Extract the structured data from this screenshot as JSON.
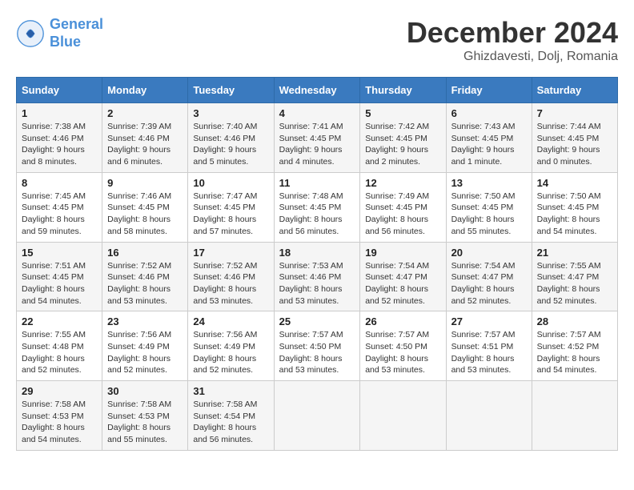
{
  "logo": {
    "line1": "General",
    "line2": "Blue"
  },
  "title": "December 2024",
  "subtitle": "Ghizdavesti, Dolj, Romania",
  "days_of_week": [
    "Sunday",
    "Monday",
    "Tuesday",
    "Wednesday",
    "Thursday",
    "Friday",
    "Saturday"
  ],
  "weeks": [
    [
      {
        "day": "1",
        "sunrise": "7:38 AM",
        "sunset": "4:46 PM",
        "daylight": "9 hours and 8 minutes."
      },
      {
        "day": "2",
        "sunrise": "7:39 AM",
        "sunset": "4:46 PM",
        "daylight": "9 hours and 6 minutes."
      },
      {
        "day": "3",
        "sunrise": "7:40 AM",
        "sunset": "4:46 PM",
        "daylight": "9 hours and 5 minutes."
      },
      {
        "day": "4",
        "sunrise": "7:41 AM",
        "sunset": "4:45 PM",
        "daylight": "9 hours and 4 minutes."
      },
      {
        "day": "5",
        "sunrise": "7:42 AM",
        "sunset": "4:45 PM",
        "daylight": "9 hours and 2 minutes."
      },
      {
        "day": "6",
        "sunrise": "7:43 AM",
        "sunset": "4:45 PM",
        "daylight": "9 hours and 1 minute."
      },
      {
        "day": "7",
        "sunrise": "7:44 AM",
        "sunset": "4:45 PM",
        "daylight": "9 hours and 0 minutes."
      }
    ],
    [
      {
        "day": "8",
        "sunrise": "7:45 AM",
        "sunset": "4:45 PM",
        "daylight": "8 hours and 59 minutes."
      },
      {
        "day": "9",
        "sunrise": "7:46 AM",
        "sunset": "4:45 PM",
        "daylight": "8 hours and 58 minutes."
      },
      {
        "day": "10",
        "sunrise": "7:47 AM",
        "sunset": "4:45 PM",
        "daylight": "8 hours and 57 minutes."
      },
      {
        "day": "11",
        "sunrise": "7:48 AM",
        "sunset": "4:45 PM",
        "daylight": "8 hours and 56 minutes."
      },
      {
        "day": "12",
        "sunrise": "7:49 AM",
        "sunset": "4:45 PM",
        "daylight": "8 hours and 56 minutes."
      },
      {
        "day": "13",
        "sunrise": "7:50 AM",
        "sunset": "4:45 PM",
        "daylight": "8 hours and 55 minutes."
      },
      {
        "day": "14",
        "sunrise": "7:50 AM",
        "sunset": "4:45 PM",
        "daylight": "8 hours and 54 minutes."
      }
    ],
    [
      {
        "day": "15",
        "sunrise": "7:51 AM",
        "sunset": "4:45 PM",
        "daylight": "8 hours and 54 minutes."
      },
      {
        "day": "16",
        "sunrise": "7:52 AM",
        "sunset": "4:46 PM",
        "daylight": "8 hours and 53 minutes."
      },
      {
        "day": "17",
        "sunrise": "7:52 AM",
        "sunset": "4:46 PM",
        "daylight": "8 hours and 53 minutes."
      },
      {
        "day": "18",
        "sunrise": "7:53 AM",
        "sunset": "4:46 PM",
        "daylight": "8 hours and 53 minutes."
      },
      {
        "day": "19",
        "sunrise": "7:54 AM",
        "sunset": "4:47 PM",
        "daylight": "8 hours and 52 minutes."
      },
      {
        "day": "20",
        "sunrise": "7:54 AM",
        "sunset": "4:47 PM",
        "daylight": "8 hours and 52 minutes."
      },
      {
        "day": "21",
        "sunrise": "7:55 AM",
        "sunset": "4:47 PM",
        "daylight": "8 hours and 52 minutes."
      }
    ],
    [
      {
        "day": "22",
        "sunrise": "7:55 AM",
        "sunset": "4:48 PM",
        "daylight": "8 hours and 52 minutes."
      },
      {
        "day": "23",
        "sunrise": "7:56 AM",
        "sunset": "4:49 PM",
        "daylight": "8 hours and 52 minutes."
      },
      {
        "day": "24",
        "sunrise": "7:56 AM",
        "sunset": "4:49 PM",
        "daylight": "8 hours and 52 minutes."
      },
      {
        "day": "25",
        "sunrise": "7:57 AM",
        "sunset": "4:50 PM",
        "daylight": "8 hours and 53 minutes."
      },
      {
        "day": "26",
        "sunrise": "7:57 AM",
        "sunset": "4:50 PM",
        "daylight": "8 hours and 53 minutes."
      },
      {
        "day": "27",
        "sunrise": "7:57 AM",
        "sunset": "4:51 PM",
        "daylight": "8 hours and 53 minutes."
      },
      {
        "day": "28",
        "sunrise": "7:57 AM",
        "sunset": "4:52 PM",
        "daylight": "8 hours and 54 minutes."
      }
    ],
    [
      {
        "day": "29",
        "sunrise": "7:58 AM",
        "sunset": "4:53 PM",
        "daylight": "8 hours and 54 minutes."
      },
      {
        "day": "30",
        "sunrise": "7:58 AM",
        "sunset": "4:53 PM",
        "daylight": "8 hours and 55 minutes."
      },
      {
        "day": "31",
        "sunrise": "7:58 AM",
        "sunset": "4:54 PM",
        "daylight": "8 hours and 56 minutes."
      },
      null,
      null,
      null,
      null
    ]
  ]
}
